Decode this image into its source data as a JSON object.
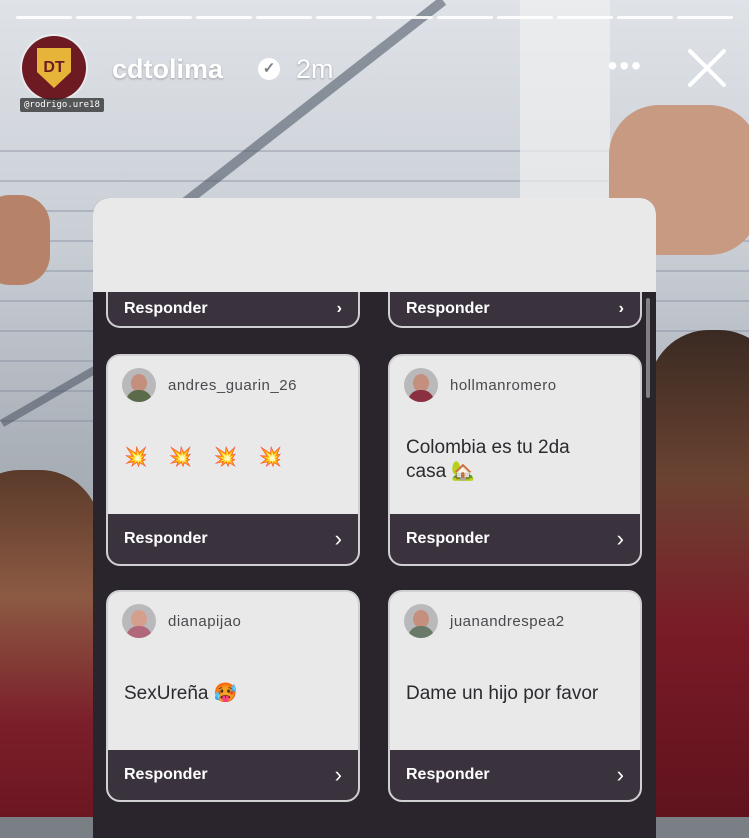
{
  "story": {
    "username": "cdtolima",
    "time": "2m",
    "mention_tag": "@rodrigo.ure18",
    "progress_segments": 12,
    "brand_color": "#6d1a22",
    "crest_letters": "DT"
  },
  "icons": {
    "verified": "verified-badge-icon",
    "more": "more-options-icon",
    "close": "close-icon",
    "chevron": "chevron-right-icon"
  },
  "reply_label": "Responder",
  "chevron_glyph": "›",
  "cards": [
    {
      "username": "andres_guarin_26",
      "message": "💥 💥 💥 💥"
    },
    {
      "username": "hollmanromero",
      "message": "Colombia es tu 2da casa 🏡"
    },
    {
      "username": "dianapijao",
      "message": "SexUreña 🥵"
    },
    {
      "username": "juanandrespea2",
      "message": "Dame un hijo por favor"
    }
  ]
}
